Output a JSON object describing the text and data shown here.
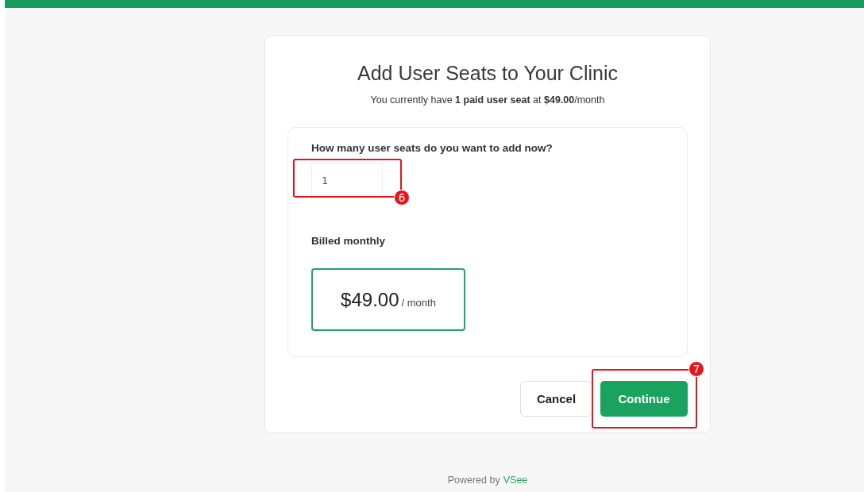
{
  "dialog": {
    "title": "Add User Seats to Your Clinic",
    "subtitle": "You currently have **1 paid user seat** at **$49.00**/month"
  },
  "seats": {
    "label": "How many user seats do you want to add now?",
    "value": "1",
    "annotation": "6"
  },
  "billing": {
    "label": "Billed monthly",
    "options": [
      {
        "price": "$49.00",
        "period": "/ month",
        "selected": true
      }
    ]
  },
  "buttons": [
    {
      "label": "Cancel",
      "kind": "secondary"
    },
    {
      "label": "Continue",
      "kind": "primary",
      "annotation": "7"
    }
  ],
  "footer": {
    "text": "Powered by",
    "brand": "VSee"
  }
}
